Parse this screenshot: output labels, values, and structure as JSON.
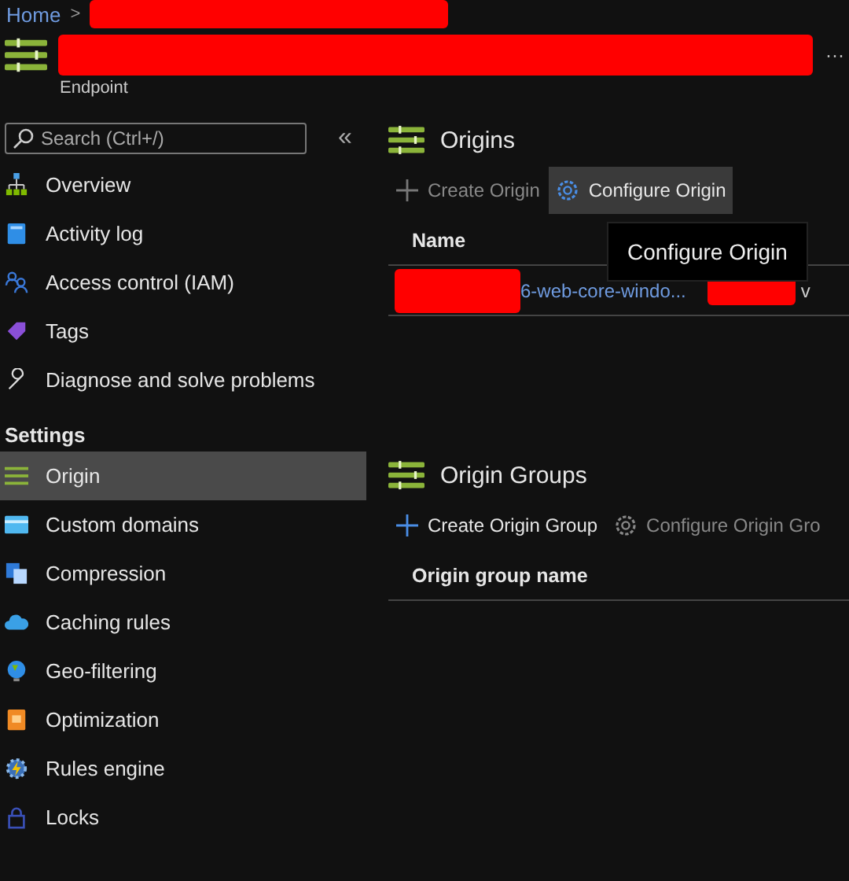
{
  "breadcrumb": {
    "home": "Home",
    "separator": ">"
  },
  "header": {
    "subtitle": "Endpoint",
    "more": "···"
  },
  "sidebar": {
    "search": {
      "placeholder": "Search (Ctrl+/)"
    },
    "collapse": "«",
    "items": [
      {
        "label": "Overview",
        "selected": false
      },
      {
        "label": "Activity log",
        "selected": false
      },
      {
        "label": "Access control (IAM)",
        "selected": false
      },
      {
        "label": "Tags",
        "selected": false
      },
      {
        "label": "Diagnose and solve problems",
        "selected": false
      }
    ],
    "section": "Settings",
    "settings_items": [
      {
        "label": "Origin",
        "selected": true
      },
      {
        "label": "Custom domains",
        "selected": false
      },
      {
        "label": "Compression",
        "selected": false
      },
      {
        "label": "Caching rules",
        "selected": false
      },
      {
        "label": "Geo-filtering",
        "selected": false
      },
      {
        "label": "Optimization",
        "selected": false
      },
      {
        "label": "Rules engine",
        "selected": false
      },
      {
        "label": "Locks",
        "selected": false
      }
    ]
  },
  "origins": {
    "title": "Origins",
    "toolbar": [
      {
        "kind": "add",
        "label": "Create Origin",
        "disabled": true,
        "hovered": false
      },
      {
        "kind": "configure",
        "label": "Configure Origin",
        "disabled": false,
        "hovered": true
      }
    ],
    "columns": [
      "Name"
    ],
    "rows": [
      {
        "name": "6-web-core-windo...",
        "column_2": "v"
      }
    ],
    "tooltip": "Configure Origin"
  },
  "origin_groups": {
    "title": "Origin Groups",
    "toolbar": [
      {
        "kind": "add",
        "label": "Create Origin Group",
        "disabled": false,
        "hovered": false
      },
      {
        "kind": "configure",
        "label": "Configure Origin Gro",
        "disabled": true,
        "hovered": false
      }
    ],
    "columns": [
      "Origin group name"
    ]
  }
}
